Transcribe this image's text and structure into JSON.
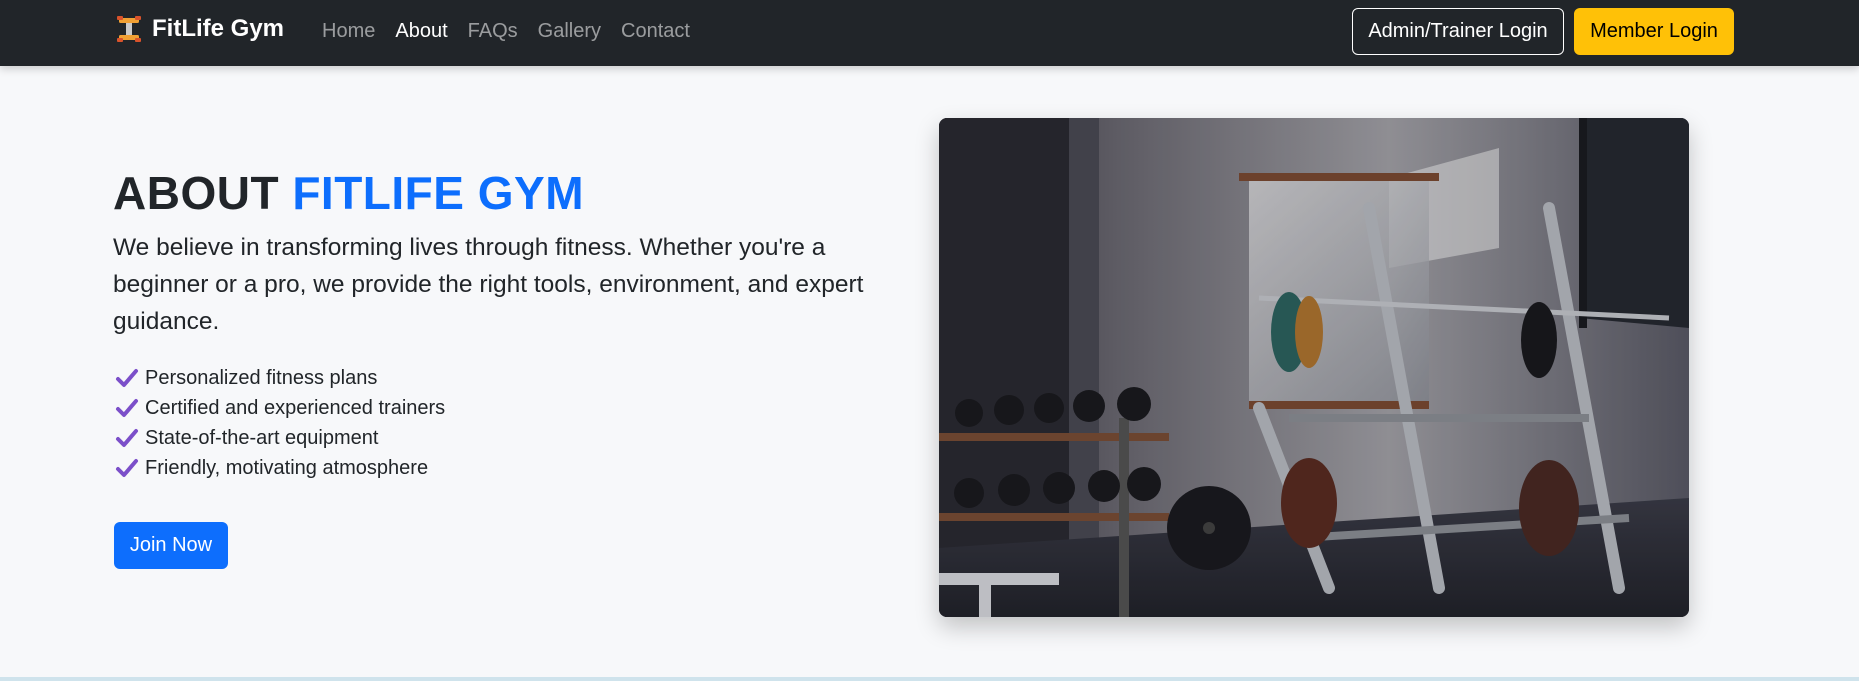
{
  "navbar": {
    "brand_icon": "dumbbell-icon",
    "brand_text": "FitLife Gym",
    "links": [
      {
        "label": "Home",
        "active": false
      },
      {
        "label": "About",
        "active": true
      },
      {
        "label": "FAQs",
        "active": false
      },
      {
        "label": "Gallery",
        "active": false
      },
      {
        "label": "Contact",
        "active": false
      }
    ],
    "admin_login_label": "Admin/Trainer Login",
    "member_login_label": "Member Login"
  },
  "about": {
    "heading_prefix": "ABOUT",
    "heading_accent": "FITLIFE GYM",
    "lead": "We believe in transforming lives through fitness. Whether you're a beginner or a pro, we provide the right tools, environment, and expert guidance.",
    "features": [
      "Personalized fitness plans",
      "Certified and experienced trainers",
      "State-of-the-art equipment",
      "Friendly, motivating atmosphere"
    ],
    "feature_icon": "check-icon",
    "cta_label": "Join Now"
  },
  "image": {
    "description_icon": "gym-interior-photo"
  },
  "colors": {
    "navbar_bg": "#212529",
    "accent_blue": "#0d6efd",
    "warning_yellow": "#ffc107",
    "check_purple": "#7b4fc9",
    "page_bg": "#f7f8fa"
  }
}
